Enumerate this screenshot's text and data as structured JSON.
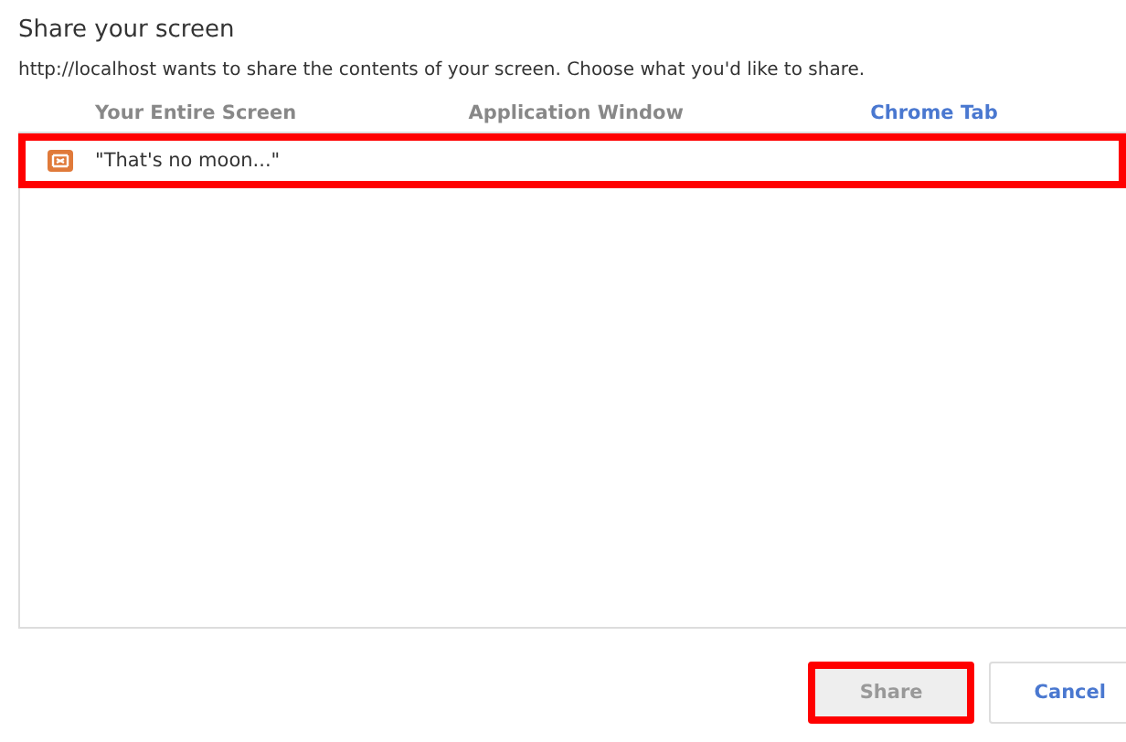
{
  "dialog": {
    "title": "Share your screen",
    "message": "http://localhost wants to share the contents of your screen. Choose what you'd like to share."
  },
  "tabs": [
    {
      "label": "Your Entire Screen",
      "selected": false
    },
    {
      "label": "Application Window",
      "selected": false
    },
    {
      "label": "Chrome Tab",
      "selected": true
    }
  ],
  "items": [
    {
      "label": "\"That's no moon...\"",
      "highlighted": true
    }
  ],
  "buttons": [
    {
      "label": "Share",
      "kind": "primary",
      "disabled": true,
      "highlighted": true
    },
    {
      "label": "Cancel",
      "kind": "secondary",
      "disabled": false,
      "highlighted": false
    }
  ]
}
